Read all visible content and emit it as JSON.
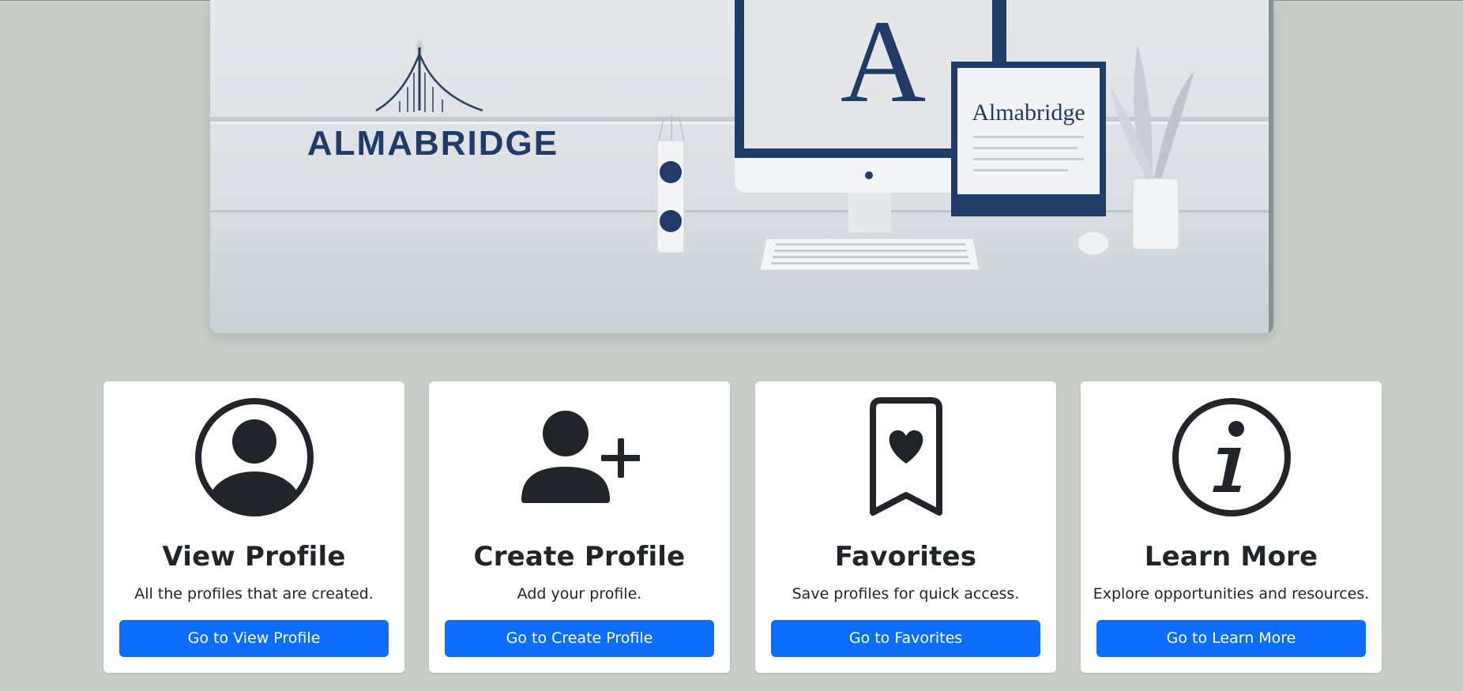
{
  "hero": {
    "logo_text": "ALMABRIDGE",
    "monitor_letter": "A",
    "frame_text": "Almabridge"
  },
  "cards": [
    {
      "icon": "person-circle-icon",
      "title": "View Profile",
      "text": "All the profiles that are created.",
      "button": "Go to View Profile"
    },
    {
      "icon": "person-plus-icon",
      "title": "Create Profile",
      "text": "Add your profile.",
      "button": "Go to Create Profile"
    },
    {
      "icon": "bookmark-heart-icon",
      "title": "Favorites",
      "text": "Save profiles for quick access.",
      "button": "Go to Favorites"
    },
    {
      "icon": "info-circle-icon",
      "title": "Learn More",
      "text": "Explore opportunities and resources.",
      "button": "Go to Learn More"
    }
  ],
  "colors": {
    "page_background": "#c8cdca",
    "primary_button": "#0d6efd",
    "icon_dark": "#212529",
    "brand_navy": "#1f3b66"
  }
}
